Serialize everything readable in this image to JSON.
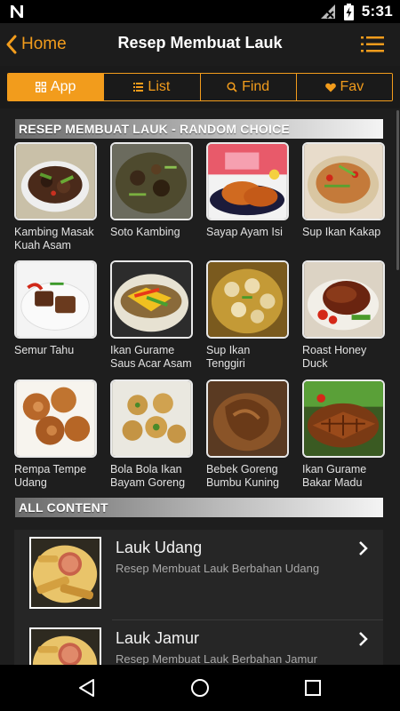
{
  "status_bar": {
    "time": "5:31",
    "icons": [
      "n-logo-icon",
      "no-signal-icon",
      "battery-charging-icon"
    ]
  },
  "app_bar": {
    "back_label": "Home",
    "title": "Resep Membuat Lauk",
    "menu_icon": "hamburger-menu-icon"
  },
  "tabs": [
    {
      "label": "App",
      "icon": "grid-icon",
      "active": true
    },
    {
      "label": "List",
      "icon": "list-icon",
      "active": false
    },
    {
      "label": "Find",
      "icon": "search-icon",
      "active": false
    },
    {
      "label": "Fav",
      "icon": "heart-icon",
      "active": false
    }
  ],
  "colors": {
    "accent": "#f29c1c",
    "background": "#1a1a1a",
    "card_border": "#e9e9e9"
  },
  "random_section": {
    "title": "RESEP MEMBUAT LAUK - RANDOM CHOICE",
    "items": [
      {
        "label": "Kambing Masak Kuah Asam"
      },
      {
        "label": "Soto Kambing"
      },
      {
        "label": "Sayap Ayam Isi"
      },
      {
        "label": "Sup Ikan Kakap"
      },
      {
        "label": "Semur Tahu"
      },
      {
        "label": "Ikan Gurame Saus Acar Asam"
      },
      {
        "label": "Sup Ikan Tenggiri"
      },
      {
        "label": "Roast Honey Duck"
      },
      {
        "label": "Rempa Tempe Udang"
      },
      {
        "label": "Bola Bola Ikan Bayam Goreng"
      },
      {
        "label": "Bebek Goreng Bumbu Kuning"
      },
      {
        "label": "Ikan Gurame Bakar Madu"
      }
    ]
  },
  "all_content": {
    "title": "ALL CONTENT",
    "items": [
      {
        "title": "Lauk Udang",
        "subtitle": "Resep Membuat Lauk Berbahan Udang"
      },
      {
        "title": "Lauk Jamur",
        "subtitle": "Resep Membuat Lauk Berbahan Jamur"
      }
    ]
  },
  "nav_bar": {
    "icons": [
      "back-triangle-icon",
      "home-circle-icon",
      "recents-square-icon"
    ]
  }
}
